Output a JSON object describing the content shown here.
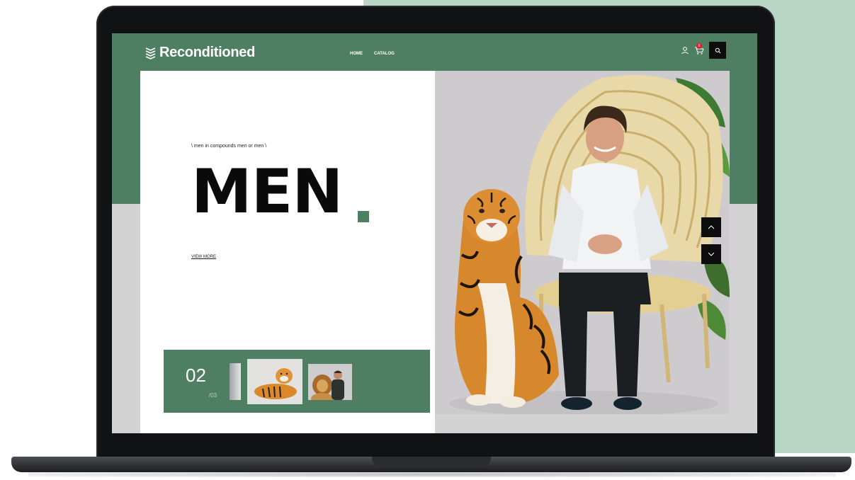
{
  "brand": {
    "name": "Reconditioned",
    "logo_icon": "stacked-chevrons-logo",
    "accent_color": "#4f7f62"
  },
  "nav": {
    "items": [
      {
        "label": "HOME"
      },
      {
        "label": "CATALOG"
      }
    ]
  },
  "header_icons": {
    "user": "user-icon",
    "cart": "cart-icon",
    "cart_count": "0",
    "search": "search-icon"
  },
  "hero": {
    "tagline": "\\ men in compounds men or men \\",
    "title": "MEN",
    "cta": "VIEW MORE",
    "image": "man seated in wicker peacock chair beside a seated tiger"
  },
  "slider": {
    "current": "02",
    "total": "/03",
    "thumbnails": [
      {
        "name": "tiger-lying"
      },
      {
        "name": "lion-and-man"
      }
    ],
    "controls": {
      "up": "chevron-up-icon",
      "down": "chevron-down-icon"
    }
  }
}
